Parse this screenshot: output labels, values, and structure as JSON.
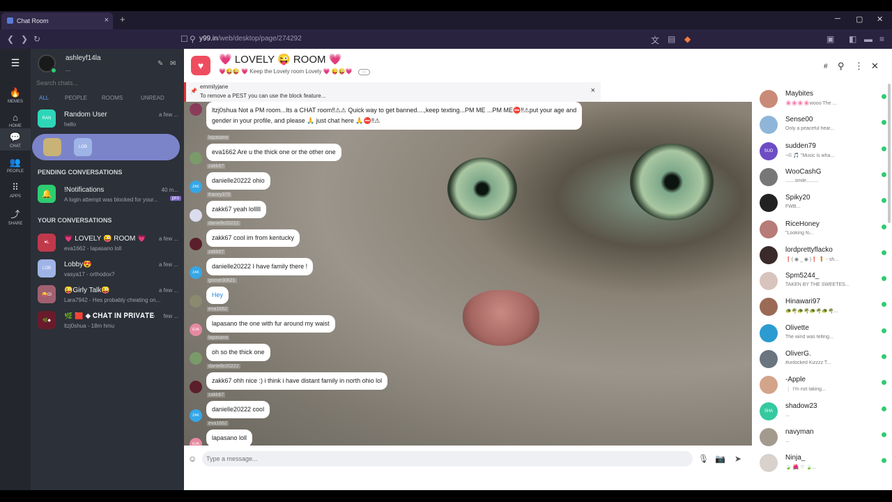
{
  "browser": {
    "tab_title": "Chat Room",
    "tab_close": "×",
    "new_tab": "+",
    "url_host": "y99.in",
    "url_path": "/web/desktop/page/274292",
    "win_min": "─",
    "win_max": "▢",
    "win_close": "✕"
  },
  "rail": [
    {
      "label": "MEMES",
      "icon": "flame-icon",
      "glyph": "🔥"
    },
    {
      "label": "HOME",
      "icon": "home-icon",
      "glyph": "⌂"
    },
    {
      "label": "CHAT",
      "icon": "chat-icon",
      "glyph": "💬"
    },
    {
      "label": "PEOPLE",
      "icon": "people-icon",
      "glyph": "👥"
    },
    {
      "label": "APPS",
      "icon": "apps-icon",
      "glyph": "⠿"
    },
    {
      "label": "SHARE",
      "icon": "share-icon",
      "glyph": "⤴"
    }
  ],
  "sidebar": {
    "username": "ashleyf14la",
    "status": "...",
    "search_placeholder": "Search chats...",
    "filters": [
      "ALL",
      "PEOPLE",
      "ROOMS",
      "UNREAD"
    ],
    "top_chats": [
      {
        "name": "Random User",
        "preview": "hello",
        "time": "a few ...",
        "avatar": "RAN",
        "color": "#2ed6b9"
      }
    ],
    "pending_title": "PENDING CONVERSATIONS",
    "pending": [
      {
        "name": "!Notifications",
        "preview": "A login attempt was blocked for your...",
        "time": "40 m...",
        "badge": "pro",
        "avatar": "",
        "color": "#2ecc71"
      }
    ],
    "yours_title": "YOUR CONVERSATIONS",
    "yours": [
      {
        "name": "💗 LOVELY 😜 ROOM 💗",
        "preview": "eva1662 - lapasano loll",
        "time": "a few ...",
        "avatar": "♥L",
        "color": "#c0394b"
      },
      {
        "name": "Lobby😍",
        "preview": "vasya17 - orthodox?",
        "time": "a few ...",
        "avatar": "LOB",
        "color": "#9fb4e6"
      },
      {
        "name": "😜Girly Talk😜",
        "preview": "Lara7942 - Hes probably cheating on...",
        "time": "a few ...",
        "avatar": "😜GI",
        "color": "#a06070"
      },
      {
        "name": "🌿 🟥 ◆ 𝐂𝐇𝐀𝐓 𝐈𝐍 𝐏𝐑𝐈𝐕𝐀𝐓𝐄◆",
        "preview": "ltzj0shua - 18m hmu",
        "time": "few ...",
        "avatar": "🌿◆",
        "color": "#6a1b2b"
      }
    ]
  },
  "room": {
    "title": "💗 LOVELY 😜 ROOM 💗",
    "subtitle": "💗😜😜 💗 Keep the Lovely room Lovely 💗 😜😜💗",
    "more_label": "···",
    "hash": "#",
    "pinned_user": "emmilyjane",
    "pinned_text": "To remove a PEST you can use the block feature...",
    "pinned_close": "×",
    "input_placeholder": "Type a message..."
  },
  "messages": [
    {
      "user": "",
      "text": "ltzj0shua Not a PM room...Its a CHAT room‼⚠⚠ Quick way to get banned....,keep texting...PM ME ...PM ME⛔‼⚠put your age and",
      "text2": "gender in your profile, and please 🙏 just chat here 🙏⛔‼⚠",
      "avatar": "",
      "color": "#8a3b5a"
    },
    {
      "user": "lapasano",
      "text": "eva1662 Are u the thick one or the other one",
      "avatar": "",
      "color": "#7a9a6a"
    },
    {
      "user": "zakk67",
      "text": "danielle20222 ohio",
      "avatar": "ZAK",
      "color": "#35a7e8"
    },
    {
      "user": "Kacey375",
      "text": "zakk67 yeah lolllll",
      "avatar": "",
      "color": "#dcdcef"
    },
    {
      "user": "danielle20222",
      "text": "zakk67 cool im from kentucky",
      "avatar": "",
      "color": "#5a1f2a"
    },
    {
      "user": "zakk67",
      "text": "danielle20222 I have family there !",
      "avatar": "ZAK",
      "color": "#35a7e8"
    },
    {
      "user": "goose30621",
      "text": "Hey",
      "avatar": "",
      "color": "#8a8a70"
    },
    {
      "user": "eva1662",
      "text": "lapasano the one with fur around my waist",
      "avatar": "EVA",
      "color": "#e68aa1"
    },
    {
      "user": "lapasano",
      "text": "oh so the thick one",
      "avatar": "",
      "color": "#7a9a6a"
    },
    {
      "user": "danielle20222",
      "text": "zakk67 ohh nice :) i think i have distant family in north ohio lol",
      "avatar": "",
      "color": "#5a1f2a"
    },
    {
      "user": "zakk67",
      "text": "danielle20222 cool",
      "avatar": "ZAK",
      "color": "#35a7e8"
    },
    {
      "user": "eva1662",
      "text": "lapasano loll",
      "avatar": "EVA",
      "color": "#e68aa1"
    }
  ],
  "users": [
    {
      "name": "Maybites",
      "status": "🌸🌸🌸🌸wooo The ...",
      "avatar": "",
      "color": "#c98b77"
    },
    {
      "name": "Sense00",
      "status": "Only a peaceful hear...",
      "avatar": "",
      "color": "#8fb6d8"
    },
    {
      "name": "sudden79",
      "status": "~© 🎵 \"Music is wha...",
      "avatar": "SUD",
      "color": "#6c4dc4"
    },
    {
      "name": "WooCashG",
      "status": ".......smile.........",
      "avatar": "",
      "color": "#777"
    },
    {
      "name": "Spiky20",
      "status": "FWB...",
      "avatar": "",
      "color": "#222"
    },
    {
      "name": "RiceHoney",
      "status": "\"Looking fo...",
      "avatar": "",
      "color": "#b77b78"
    },
    {
      "name": "lordprettyflacko",
      "status": "❗( ◉ _ ◉ )❗ 🧍 - sh...",
      "avatar": "",
      "color": "#3a2a2a"
    },
    {
      "name": "Spm5244_",
      "status": "TAKEN BY THE SWEETES...",
      "avatar": "",
      "color": "#d8c4bd"
    },
    {
      "name": "Hinawari97",
      "status": "🐢🌴🐢🌴🐢🌴🐢🌴...",
      "avatar": "",
      "color": "#9b6a55"
    },
    {
      "name": "Olivette",
      "status": "The wind was telling...",
      "avatar": "",
      "color": "#2b9bd0"
    },
    {
      "name": "OliverG.",
      "status": "#unlocked Kizzzz T...",
      "avatar": "",
      "color": "#6a7580"
    },
    {
      "name": "-Apple",
      "status": "❕ I'm not taking...",
      "avatar": "",
      "color": "#d4a48a"
    },
    {
      "name": "shadow23",
      "status": "...",
      "avatar": "SHA",
      "color": "#35c9a0"
    },
    {
      "name": "navyman",
      "status": "...",
      "avatar": "",
      "color": "#a39a8e"
    },
    {
      "name": "Ninja_",
      "status": "🍃 🌺 ♡ 🍃...",
      "avatar": "",
      "color": "#d9d2cc"
    }
  ]
}
